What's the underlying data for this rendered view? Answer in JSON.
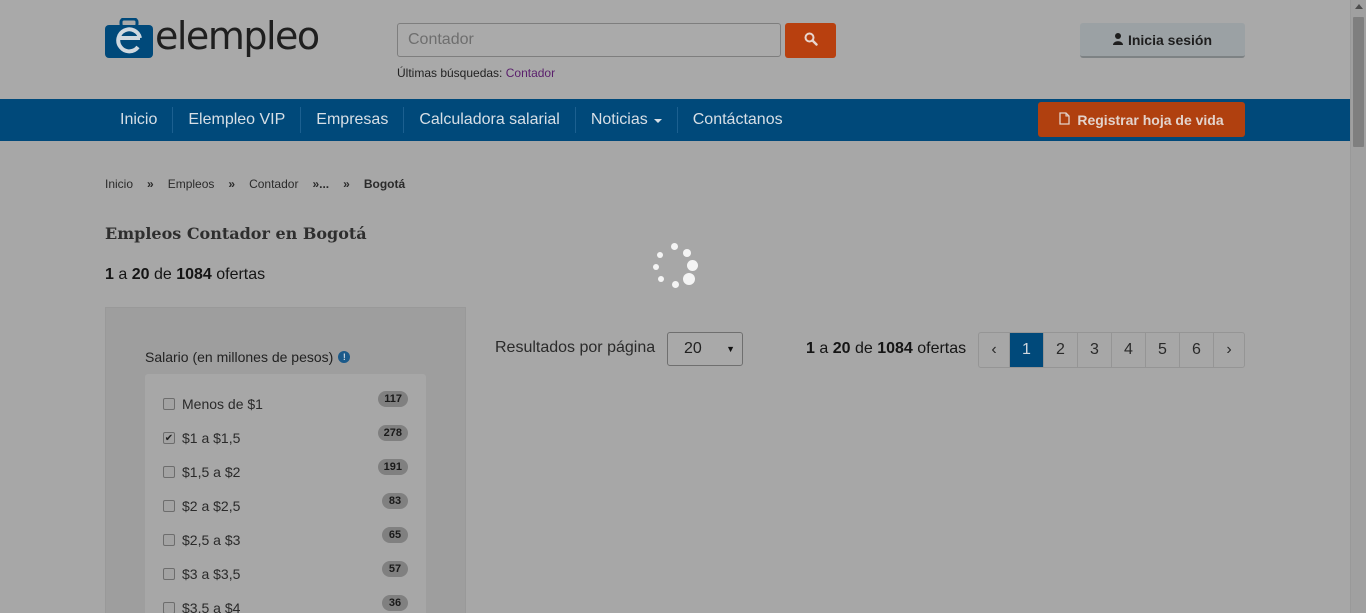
{
  "header": {
    "logo_text": "elempleo",
    "search_placeholder": "Contador",
    "recent_label": "Últimas búsquedas: ",
    "recent_link": "Contador",
    "login_label": "Inicia sesión"
  },
  "nav": {
    "items": [
      {
        "label": "Inicio"
      },
      {
        "label": "Elempleo VIP"
      },
      {
        "label": "Empresas"
      },
      {
        "label": "Calculadora salarial"
      },
      {
        "label": "Noticias"
      },
      {
        "label": "Contáctanos"
      }
    ],
    "register_label": "Registrar hoja de vida"
  },
  "breadcrumb": {
    "items": [
      "Inicio",
      "Empleos",
      "Contador",
      "..."
    ],
    "current": "Bogotá",
    "separator": "»"
  },
  "page": {
    "title": "Empleos Contador en Bogotá",
    "count_from": "1",
    "count_a": " a ",
    "count_to": "20",
    "count_de": " de ",
    "count_total": "1084",
    "count_suffix": " ofertas"
  },
  "filter": {
    "title": "Salario (en millones de pesos)",
    "items": [
      {
        "label": "Menos de $1",
        "count": "117",
        "checked": false
      },
      {
        "label": "$1 a $1,5",
        "count": "278",
        "checked": true
      },
      {
        "label": "$1,5 a $2",
        "count": "191",
        "checked": false
      },
      {
        "label": "$2 a $2,5",
        "count": "83",
        "checked": false
      },
      {
        "label": "$2,5 a $3",
        "count": "65",
        "checked": false
      },
      {
        "label": "$3 a $3,5",
        "count": "57",
        "checked": false
      },
      {
        "label": "$3,5 a $4",
        "count": "36",
        "checked": false
      }
    ]
  },
  "results": {
    "per_page_label": "Resultados por página",
    "per_page_value": "20",
    "pages": [
      "1",
      "2",
      "3",
      "4",
      "5",
      "6"
    ],
    "active_page": "1",
    "prev_symbol": "‹",
    "next_symbol": "›"
  },
  "colors": {
    "nav_bg": "#00497a",
    "accent_orange": "#b0400f"
  }
}
